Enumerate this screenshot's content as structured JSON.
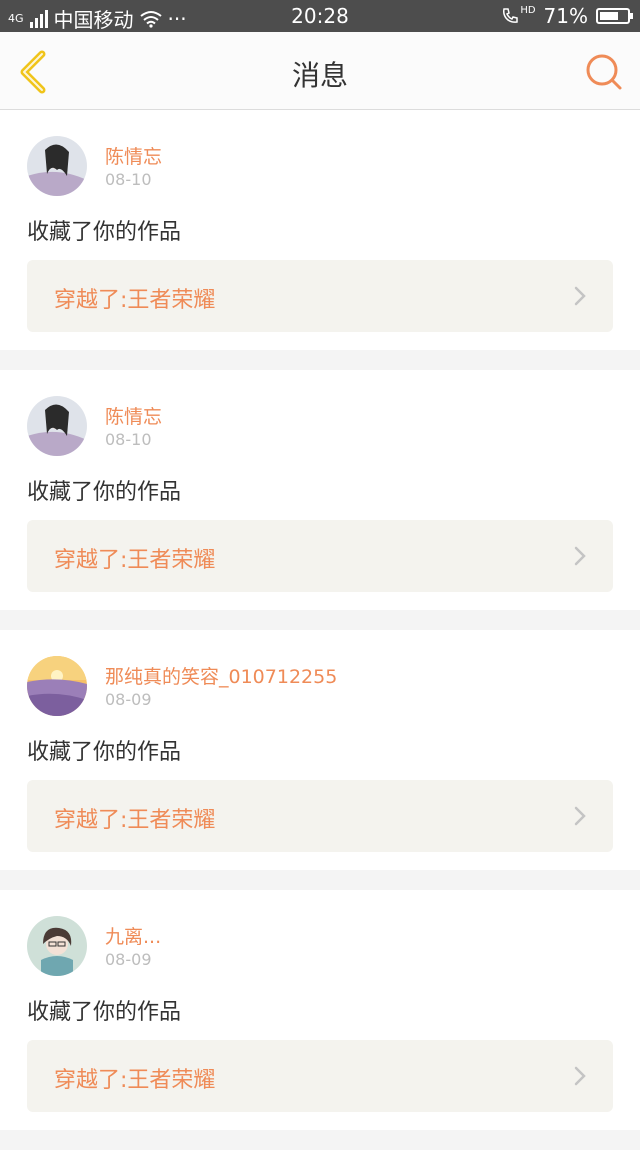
{
  "status_bar": {
    "network": "4G",
    "carrier": "中国移动",
    "more": "···",
    "time": "20:28",
    "hd": "HD",
    "battery_text": "71%",
    "battery_level": 0.71
  },
  "nav": {
    "title": "消息"
  },
  "messages": [
    {
      "username": "陈情忘",
      "date": "08-10",
      "action": "收藏了你的作品",
      "work_title": "穿越了:王者荣耀"
    },
    {
      "username": "陈情忘",
      "date": "08-10",
      "action": "收藏了你的作品",
      "work_title": "穿越了:王者荣耀"
    },
    {
      "username": "那纯真的笑容_010712255",
      "date": "08-09",
      "action": "收藏了你的作品",
      "work_title": "穿越了:王者荣耀"
    },
    {
      "username": "九离...",
      "date": "08-09",
      "action": "收藏了你的作品",
      "work_title": "穿越了:王者荣耀"
    }
  ],
  "colors": {
    "accent": "#ef8b57",
    "back_icon": "#f0c419",
    "status_bar": "#4d4d4d",
    "link_bg": "#f4f3ee"
  },
  "icons": [
    "back-arrow-icon",
    "search-icon",
    "chevron-right-icon",
    "wifi-icon",
    "call-hd-icon",
    "battery-icon",
    "signal-icon"
  ]
}
